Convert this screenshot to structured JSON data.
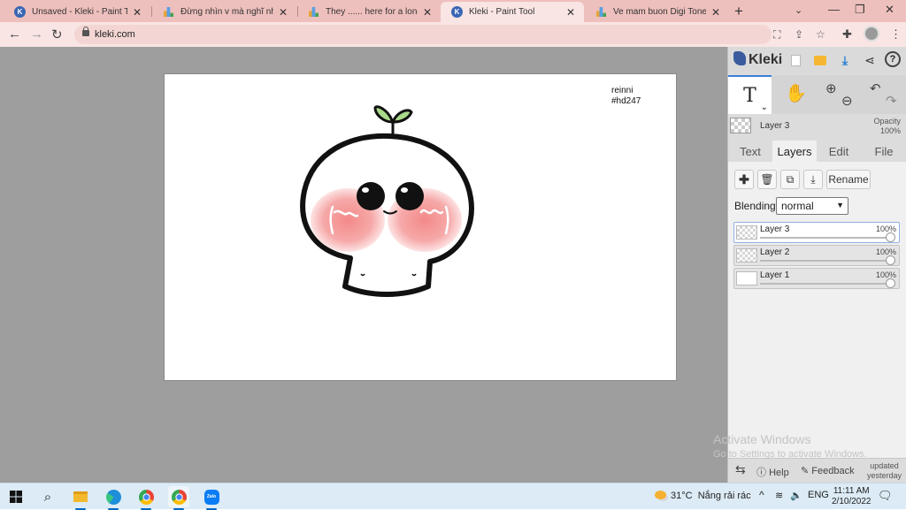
{
  "browser": {
    "tabs": [
      {
        "title": "Unsaved - Kleki - Paint Tool",
        "favicon": "kleki-icon",
        "active": false
      },
      {
        "title": "Đừng nhìn v mà nghĩ nhiều c",
        "favicon": "docs-icon",
        "active": false
      },
      {
        "title": "They ...... here for a long time",
        "favicon": "docs-icon",
        "active": false
      },
      {
        "title": "Kleki - Paint Tool",
        "favicon": "kleki-icon",
        "active": true
      },
      {
        "title": "Ve mam buon Digi Tone dark",
        "favicon": "docs-icon",
        "active": false
      }
    ],
    "url": "kleki.com"
  },
  "canvas": {
    "text_line1": "reinni",
    "text_line2": "#hd247"
  },
  "panel": {
    "logo": "Kleki",
    "current_layer": "Layer 3",
    "opacity_label": "Opacity",
    "opacity_value": "100%",
    "tabs": [
      "Text",
      "Layers",
      "Edit",
      "File"
    ],
    "active_tab": "Layers",
    "rename_label": "Rename",
    "blending_label": "Blending",
    "blending_value": "normal",
    "layers": [
      {
        "name": "Layer 3",
        "opacity": "100%",
        "selected": true
      },
      {
        "name": "Layer 2",
        "opacity": "100%",
        "selected": false
      },
      {
        "name": "Layer 1",
        "opacity": "100%",
        "selected": false
      }
    ],
    "help_label": "Help",
    "feedback_label": "Feedback",
    "updated_line1": "updated",
    "updated_line2": "yesterday"
  },
  "watermark": {
    "line1": "Activate Windows",
    "line2": "Go to Settings to activate Windows."
  },
  "taskbar": {
    "temperature": "31°C",
    "weather": "Nắng rải rác",
    "language": "ENG",
    "time": "11:11 AM",
    "date": "2/10/2022"
  },
  "colors": {
    "tabstrip": "#eec0bd",
    "toolbar": "#f9e5e3",
    "workspace": "#9e9e9e",
    "accent": "#3a7fd5"
  }
}
